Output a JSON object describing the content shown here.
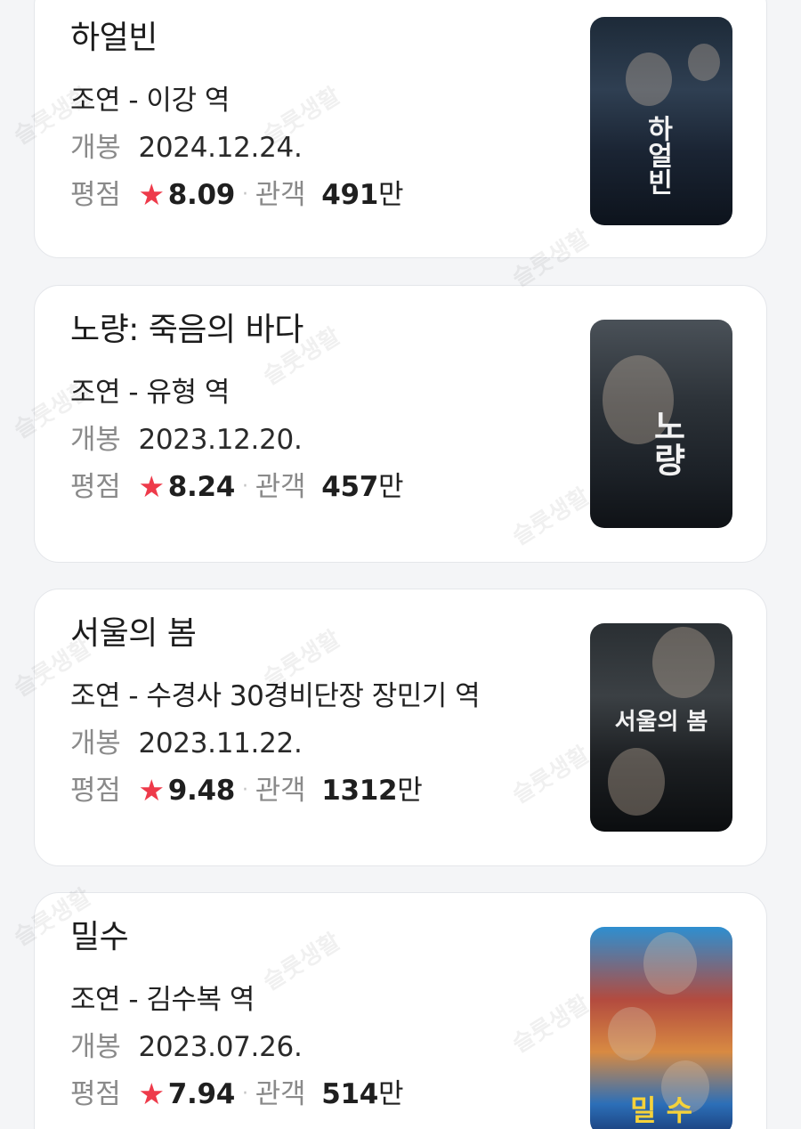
{
  "movies": [
    {
      "title": "하얼빈",
      "role": "조연 - 이강 역",
      "release_label": "개봉",
      "release_date": "2024.12.24.",
      "rating_label": "평점",
      "star": "★",
      "rating": "8.09",
      "separator": "·",
      "audience_label": "관객",
      "audience_number": "491",
      "audience_unit": "만",
      "poster_text": "하얼빈"
    },
    {
      "title": "노량: 죽음의 바다",
      "role": "조연 - 유형 역",
      "release_label": "개봉",
      "release_date": "2023.12.20.",
      "rating_label": "평점",
      "star": "★",
      "rating": "8.24",
      "separator": "·",
      "audience_label": "관객",
      "audience_number": "457",
      "audience_unit": "만",
      "poster_text": "노량"
    },
    {
      "title": "서울의 봄",
      "role": "조연 - 수경사 30경비단장 장민기 역",
      "release_label": "개봉",
      "release_date": "2023.11.22.",
      "rating_label": "평점",
      "star": "★",
      "rating": "9.48",
      "separator": "·",
      "audience_label": "관객",
      "audience_number": "1312",
      "audience_unit": "만",
      "poster_text": "서울의 봄"
    },
    {
      "title": "밀수",
      "role": "조연 - 김수복 역",
      "release_label": "개봉",
      "release_date": "2023.07.26.",
      "rating_label": "평점",
      "star": "★",
      "rating": "7.94",
      "separator": "·",
      "audience_label": "관객",
      "audience_number": "514",
      "audience_unit": "만",
      "poster_text": "밀 수"
    }
  ],
  "watermark_text": "슬룻생활",
  "colors": {
    "star": "#ee3a4a",
    "label_gray": "#8a8a8a",
    "card_border": "#e4e6ea",
    "background": "#f4f5f7"
  }
}
